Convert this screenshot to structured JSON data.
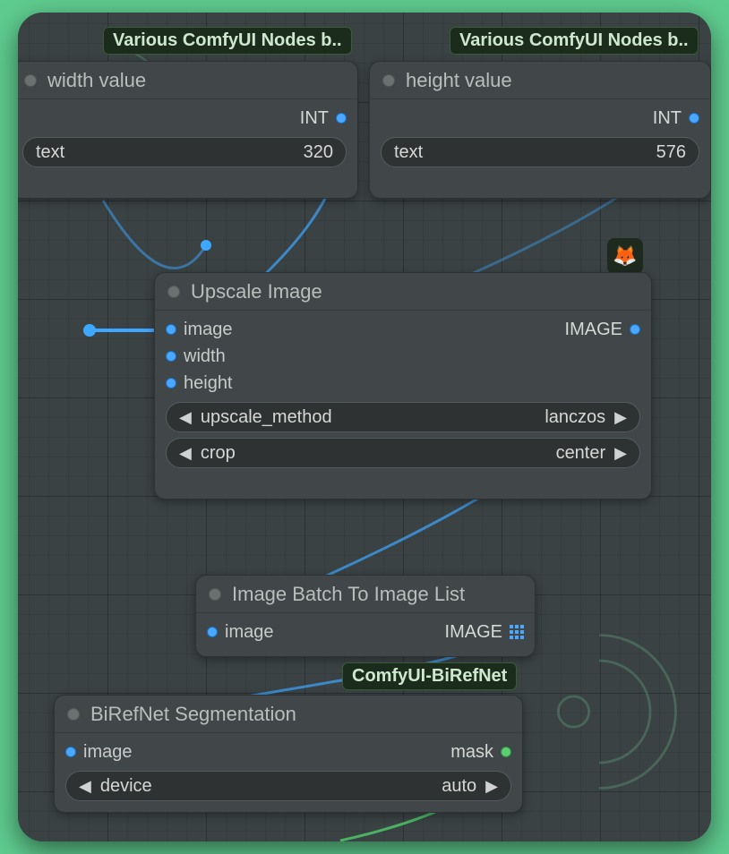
{
  "badges": {
    "various1": "Various ComfyUI Nodes b..",
    "various2": "Various ComfyUI Nodes b..",
    "birefnet": "ComfyUI-BiRefNet"
  },
  "nodes": {
    "width": {
      "title": "width value",
      "out_label": "INT",
      "field_label": "text",
      "field_value": "320"
    },
    "height": {
      "title": "height value",
      "out_label": "INT",
      "field_label": "text",
      "field_value": "576"
    },
    "upscale": {
      "title": "Upscale Image",
      "in_image": "image",
      "in_width": "width",
      "in_height": "height",
      "out_label": "IMAGE",
      "method_label": "upscale_method",
      "method_value": "lanczos",
      "crop_label": "crop",
      "crop_value": "center"
    },
    "batch2list": {
      "title": "Image Batch To Image List",
      "in_image": "image",
      "out_label": "IMAGE"
    },
    "biref": {
      "title": "BiRefNet Segmentation",
      "in_image": "image",
      "out_mask": "mask",
      "device_label": "device",
      "device_value": "auto"
    }
  },
  "fox_emoji": "🦊"
}
